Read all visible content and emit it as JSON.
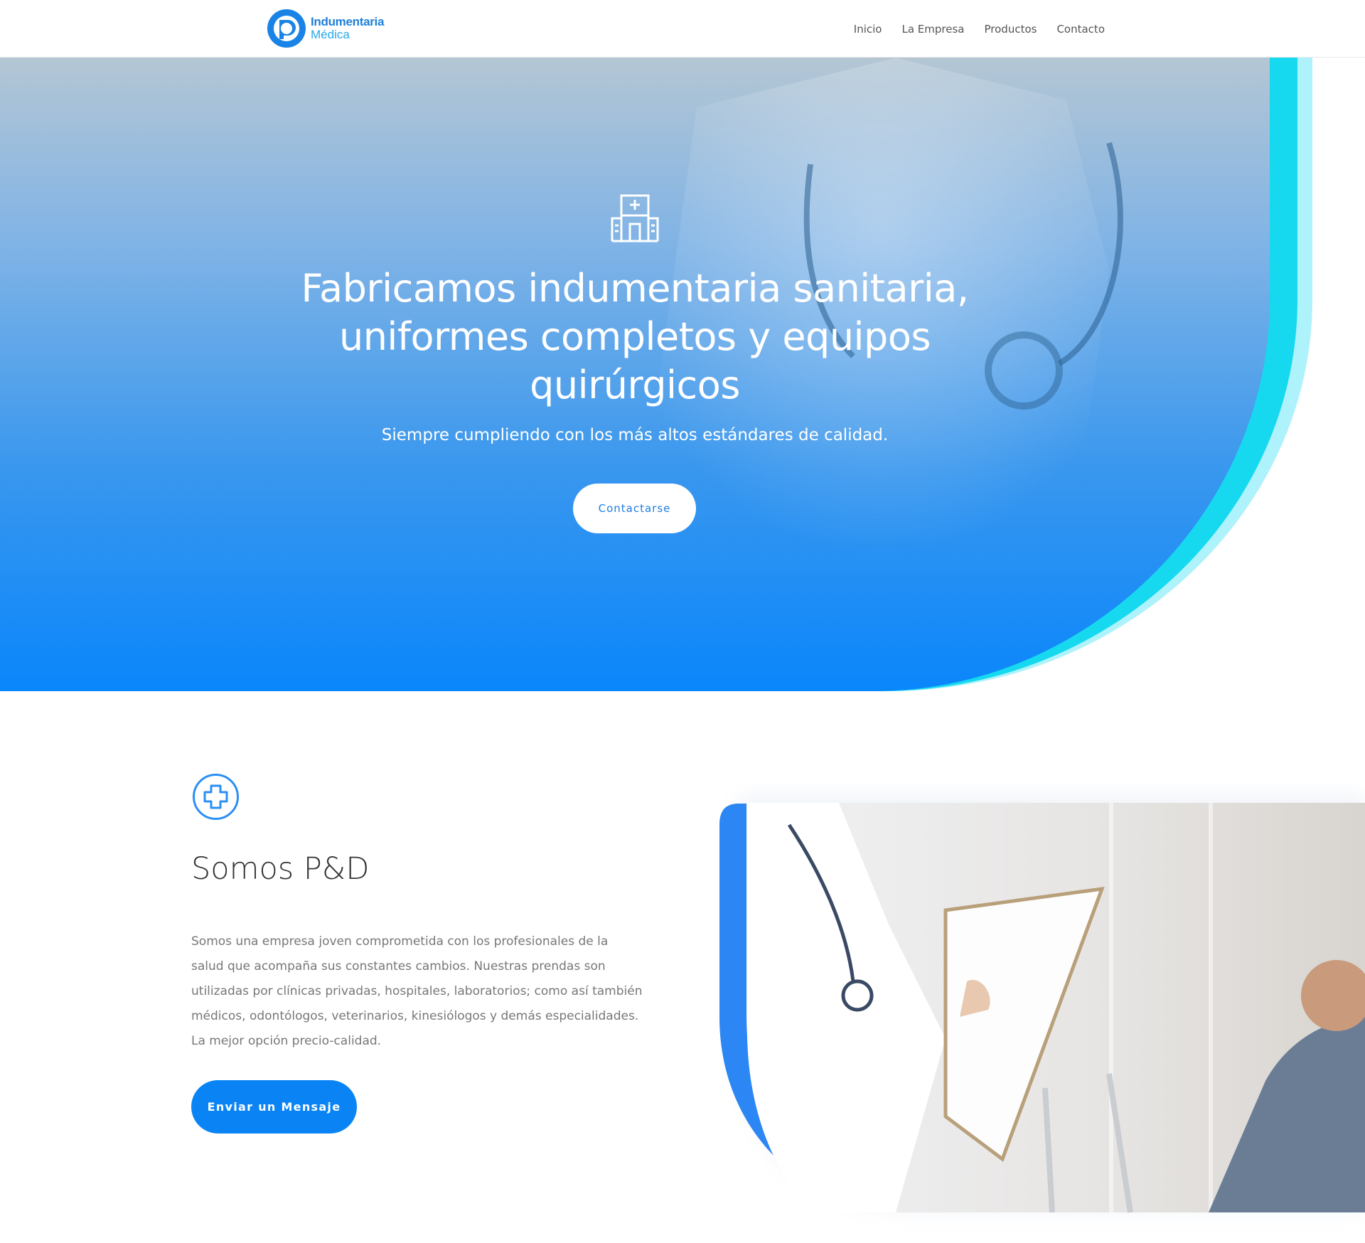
{
  "header": {
    "brand_line1": "Indumentaria",
    "brand_line2": "Médica",
    "nav": [
      {
        "label": "Inicio"
      },
      {
        "label": "La Empresa"
      },
      {
        "label": "Productos"
      },
      {
        "label": "Contacto"
      }
    ]
  },
  "hero": {
    "icon": "hospital-icon",
    "title_line1": "Fabricamos indumentaria sanitaria,",
    "title_line2": "uniformes completos y equipos",
    "title_line3": "quirúrgicos",
    "subtitle": "Siempre cumpliendo con los más altos estándares de calidad.",
    "button": "Contactarse"
  },
  "about": {
    "icon": "plus-circle-icon",
    "title": "Somos P&D",
    "paragraph_lines": [
      "Somos una empresa joven comprometida con los profesionales de la",
      "salud que acompaña sus constantes cambios. Nuestras prendas son",
      "utilizadas por clínicas privadas, hospitales, laboratorios; como así también",
      "médicos, odontólogos, veterinarios, kinesiólogos y demás especialidades.",
      "La mejor opción precio-calidad."
    ],
    "button": "Enviar un Mensaje"
  },
  "colors": {
    "brand_blue": "#0a84f5",
    "cyan_accent": "#16d9f0",
    "light_cyan": "#aef2fb",
    "text_gray": "#777777"
  }
}
